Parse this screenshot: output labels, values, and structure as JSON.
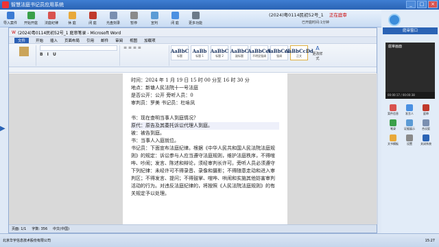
{
  "app": {
    "title": "智慧法庭书记员应用系统"
  },
  "toolbar": {
    "buttons": [
      "导入案件",
      "开始开庭",
      "法庭纪律",
      "休 庭",
      "闭 庭",
      "光盘刻录",
      "暂停",
      "宣判",
      "闭 庭",
      "更多功能"
    ]
  },
  "case": {
    "number": "(2024)粤0114民初52号_1",
    "status": "正在庭审",
    "elapsed_label": "已开庭时间:",
    "elapsed": "1分钟"
  },
  "word": {
    "title": "(2024)粤0114民初52号_1 庭审笔录 - Microsoft Word",
    "tabs": [
      "文件",
      "开始",
      "插入",
      "页面布局",
      "引用",
      "邮件",
      "审阅",
      "视图",
      "加载项"
    ],
    "styles": [
      {
        "sample": "AaBbC",
        "name": "标题"
      },
      {
        "sample": "AaBb",
        "name": "标题 1"
      },
      {
        "sample": "AaBbC",
        "name": "标题 2"
      },
      {
        "sample": "AaBbC",
        "name": "副标题"
      },
      {
        "sample": "AaBbCcI",
        "name": "不明显强调"
      },
      {
        "sample": "AaBbCcD",
        "name": "强调"
      },
      {
        "sample": "AaBbCcDd",
        "name": "正文"
      }
    ],
    "change_styles": "更改样式",
    "lines": [
      "时间：2024 年 1 月 19 日 15 时 00 分至 16 时 30 分",
      "地点：新塘人民法院十一号法庭",
      "是否公开：公开          旁听人员：0",
      "审判员：罗美          书记员：杜咏凤",
      "",
      "书：现在查明当事人到庭情况？",
      "原代：原告及其委托诉讼代理人到庭。",
      "被：被告到庭。",
      "书：当事人入庭就位。",
      "书记员：下面宣布法庭纪律。根据《中华人民共和国人民法院法庭规则》的规定：诉讼参与人应当遵守法庭规则，维护法庭秩序，不得喧哗、吵闹；发言、陈述和辩论，须经审判长许可。旁听人员必须遵守下列纪律：未经许可不得录音、录像和摄影；不得随意走动和进入审判区；不得发言、提问；不得鼓掌、喧哗、哄闹和实施其他妨害审判活动的行为。对违反法庭纪律的，将按照《人民法院法庭规则》的有关规定予以处理。"
    ],
    "status": {
      "page": "页面: 1/1",
      "words": "字数: 356",
      "lang": "中文(中国)"
    }
  },
  "right": {
    "header": "庭审窗口",
    "video_label": "庭审画面",
    "video_time": "00:00:17 / 00:00:38",
    "buttons": [
      "案件信息",
      "发言人",
      "庭审",
      "笔录",
      "证据展示",
      "合议庭",
      "文书模板",
      "设置",
      "关闭系统"
    ]
  },
  "taskbar": {
    "left": "北京华宇信息技术股份有限公司",
    "clock": "15:27"
  }
}
